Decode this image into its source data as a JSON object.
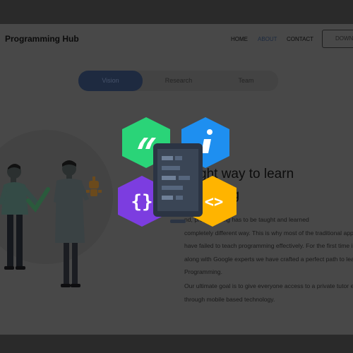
{
  "header": {
    "brand": "Programming Hub",
    "nav": [
      "HOME",
      "ABOUT",
      "CONTACT"
    ],
    "download_label": "DOWN"
  },
  "tabs": [
    "Vision",
    "Research",
    "Team"
  ],
  "main": {
    "headline_line1": "ght way to learn",
    "headline_line2": "mming",
    "paragraph1_lines": [
      "nd, programming has to be taught and learned",
      "completely different way. This is why most of the traditional appr",
      "have failed to teach programming effectively. For the first time in",
      "along with Google experts we have crafted a perfect path to lear",
      "Programming."
    ],
    "paragraph2_lines": [
      "Our ultimate goal is to give everyone access to a private tutor ex",
      "through mobile based technology."
    ]
  },
  "colors": {
    "hex_green": "#2ad478",
    "hex_blue": "#1e8ff0",
    "hex_purple": "#7c3de0",
    "hex_orange": "#ffb400",
    "phone": "#3a4555",
    "accent_tab": "#1e2a40"
  },
  "icons": [
    "quote-icon",
    "info-icon",
    "braces-icon",
    "code-icon",
    "robot-icon",
    "checkmark-icon"
  ]
}
